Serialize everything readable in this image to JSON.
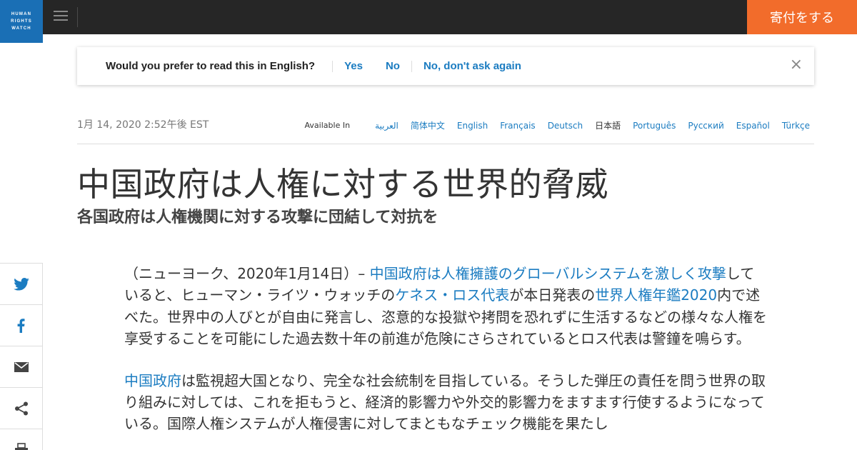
{
  "header": {
    "logo_lines": [
      "HUMAN",
      "RIGHTS",
      "WATCH"
    ],
    "donate_label": "寄付をする"
  },
  "language_prompt": {
    "question": "Would you prefer to read this in English?",
    "yes": "Yes",
    "no": "No",
    "never": "No, don't ask again",
    "close": "×"
  },
  "meta": {
    "date": "1月 14, 2020 2:52午後 EST",
    "available_in": "Available In",
    "languages": [
      "العربية",
      "简体中文",
      "English",
      "Français",
      "Deutsch",
      "日本語",
      "Português",
      "Русский",
      "Español",
      "Türkçe"
    ]
  },
  "article": {
    "title": "中国政府は人権に対する世界的脅威",
    "subtitle": "各国政府は人権機関に対する攻撃に団結して対抗を",
    "p1": {
      "t1": "（ニューヨーク、2020年1月14日）– ",
      "l1": "中国政府は人権擁護のグローバルシステムを激しく攻撃",
      "t2": "していると、ヒューマン・ライツ・ウォッチの",
      "l2": "ケネス・ロス代表",
      "t3": "が本日発表の",
      "l3": "世界人権年鑑2020",
      "t4": "内で述べた。世界中の人びとが自由に発言し、恣意的な投獄や拷問を恐れずに生活するなどの様々な人権を享受することを可能にした過去数十年の前進が危険にさらされているとロス代表は警鐘を鳴らす。"
    },
    "p2": {
      "l1": "中国政府",
      "t1": "は監視超大国となり、完全な社会統制を目指している。そうした弾圧の責任を問う世界の取り組みに対しては、これを拒もうと、経済的影響力や外交的影響力をますます行使するようになっている。国際人権システムが人権侵害に対してまともなチェック機能を果たし"
    }
  },
  "share": {
    "icons": [
      "twitter-icon",
      "facebook-icon",
      "email-icon",
      "share-icon",
      "print-icon"
    ]
  },
  "colors": {
    "topbar": "#262626",
    "logo": "#1a6fb5",
    "donate": "#f26c2b",
    "link": "#1b7cc1"
  }
}
